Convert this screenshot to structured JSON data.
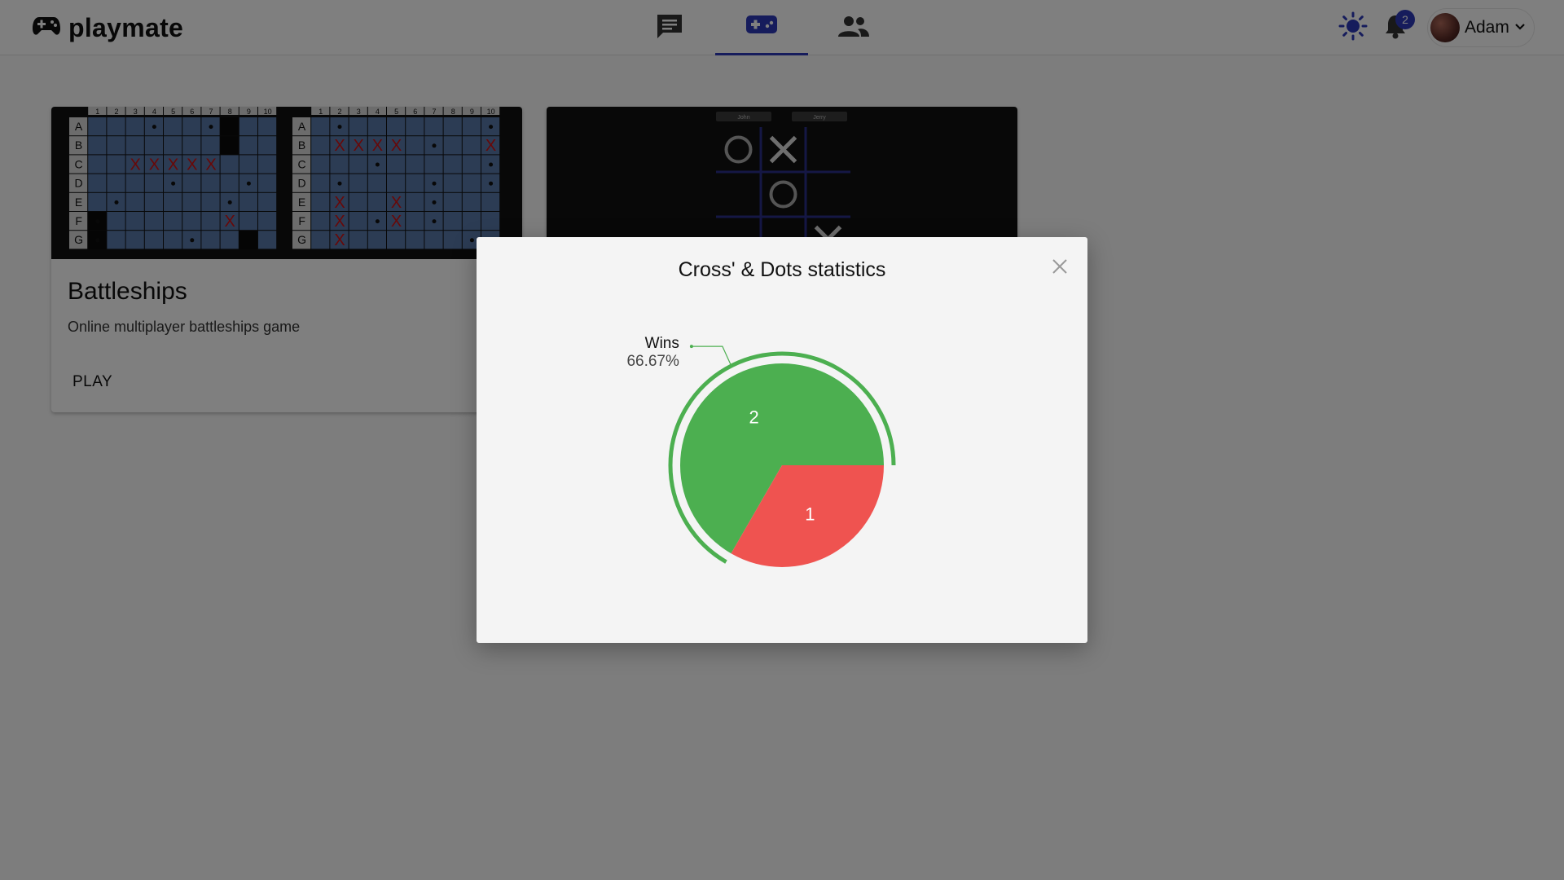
{
  "app": {
    "name": "playmate"
  },
  "nav": {
    "tabs": [
      {
        "name": "chat",
        "icon": "chat-icon",
        "active": false
      },
      {
        "name": "games",
        "icon": "gamepad-icon",
        "active": true
      },
      {
        "name": "friends",
        "icon": "people-icon",
        "active": false
      }
    ]
  },
  "toolbar": {
    "theme_icon": "sun-icon",
    "notifications_icon": "bell-icon",
    "notification_count": "2",
    "user_name": "Adam"
  },
  "cards": [
    {
      "title": "Battleships",
      "description": "Online multiplayer battleships game",
      "action": "PLAY"
    }
  ],
  "battleship_preview": {
    "row_labels": [
      "A",
      "B",
      "C",
      "D",
      "E",
      "F",
      "G"
    ],
    "col_labels": [
      "1",
      "2",
      "3",
      "4",
      "5",
      "6",
      "7",
      "8",
      "9",
      "10"
    ]
  },
  "tictactoe_preview": {
    "players": [
      "John",
      "Jerry"
    ],
    "marks": [
      "O",
      "X",
      "",
      "",
      "O",
      "",
      "",
      "",
      "X"
    ]
  },
  "modal": {
    "title": "Cross' & Dots statistics"
  },
  "chart_data": {
    "type": "pie",
    "title": "Cross' & Dots statistics",
    "slices": [
      {
        "label": "Wins",
        "value": 2,
        "percent_label": "66.67%",
        "color": "#4caf50"
      },
      {
        "label": "",
        "value": 1,
        "color": "#ef5350"
      }
    ]
  },
  "colors": {
    "accent": "#2d39b8",
    "win": "#4caf50",
    "loss": "#ef5350"
  }
}
